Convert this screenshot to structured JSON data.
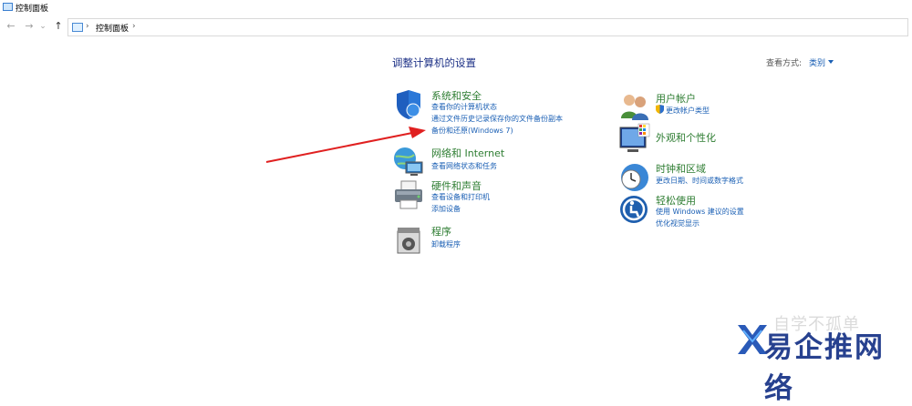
{
  "window": {
    "title": "控制面板"
  },
  "nav": {
    "back_glyph": "←",
    "forward_glyph": "→",
    "recent_glyph": "⌄",
    "up_glyph": "↑",
    "breadcrumb_sep": "›",
    "breadcrumb": "控制面板",
    "breadcrumb_trailing_sep": "›"
  },
  "page": {
    "title": "调整计算机的设置",
    "viewby_label": "查看方式:",
    "viewby_value": "类别"
  },
  "left_categories": [
    {
      "title": "系统和安全",
      "icon": "shield-icon",
      "links": [
        "查看你的计算机状态",
        "通过文件历史记录保存你的文件备份副本",
        "备份和还原(Windows 7)"
      ]
    },
    {
      "title": "网络和 Internet",
      "icon": "network-icon",
      "links": [
        "查看网络状态和任务"
      ]
    },
    {
      "title": "硬件和声音",
      "icon": "printer-icon",
      "links": [
        "查看设备和打印机",
        "添加设备"
      ]
    },
    {
      "title": "程序",
      "icon": "programs-icon",
      "links": [
        "卸载程序"
      ]
    }
  ],
  "right_categories": [
    {
      "title": "用户帐户",
      "icon": "users-icon",
      "links": [
        "更改帐户类型"
      ]
    },
    {
      "title": "外观和个性化",
      "icon": "appearance-icon",
      "links": []
    },
    {
      "title": "时钟和区域",
      "icon": "clock-icon",
      "links": [
        "更改日期、时间或数字格式"
      ]
    },
    {
      "title": "轻松使用",
      "icon": "accessibility-icon",
      "links": [
        "使用 Windows 建议的设置",
        "优化视觉显示"
      ]
    }
  ],
  "watermark": {
    "text": "自学不孤单",
    "brand": "易企推网络"
  },
  "colors": {
    "title_blue": "#1e3287",
    "link_blue": "#1a5fb4",
    "category_green": "#2e7d32",
    "annotation_red": "#e02020"
  }
}
